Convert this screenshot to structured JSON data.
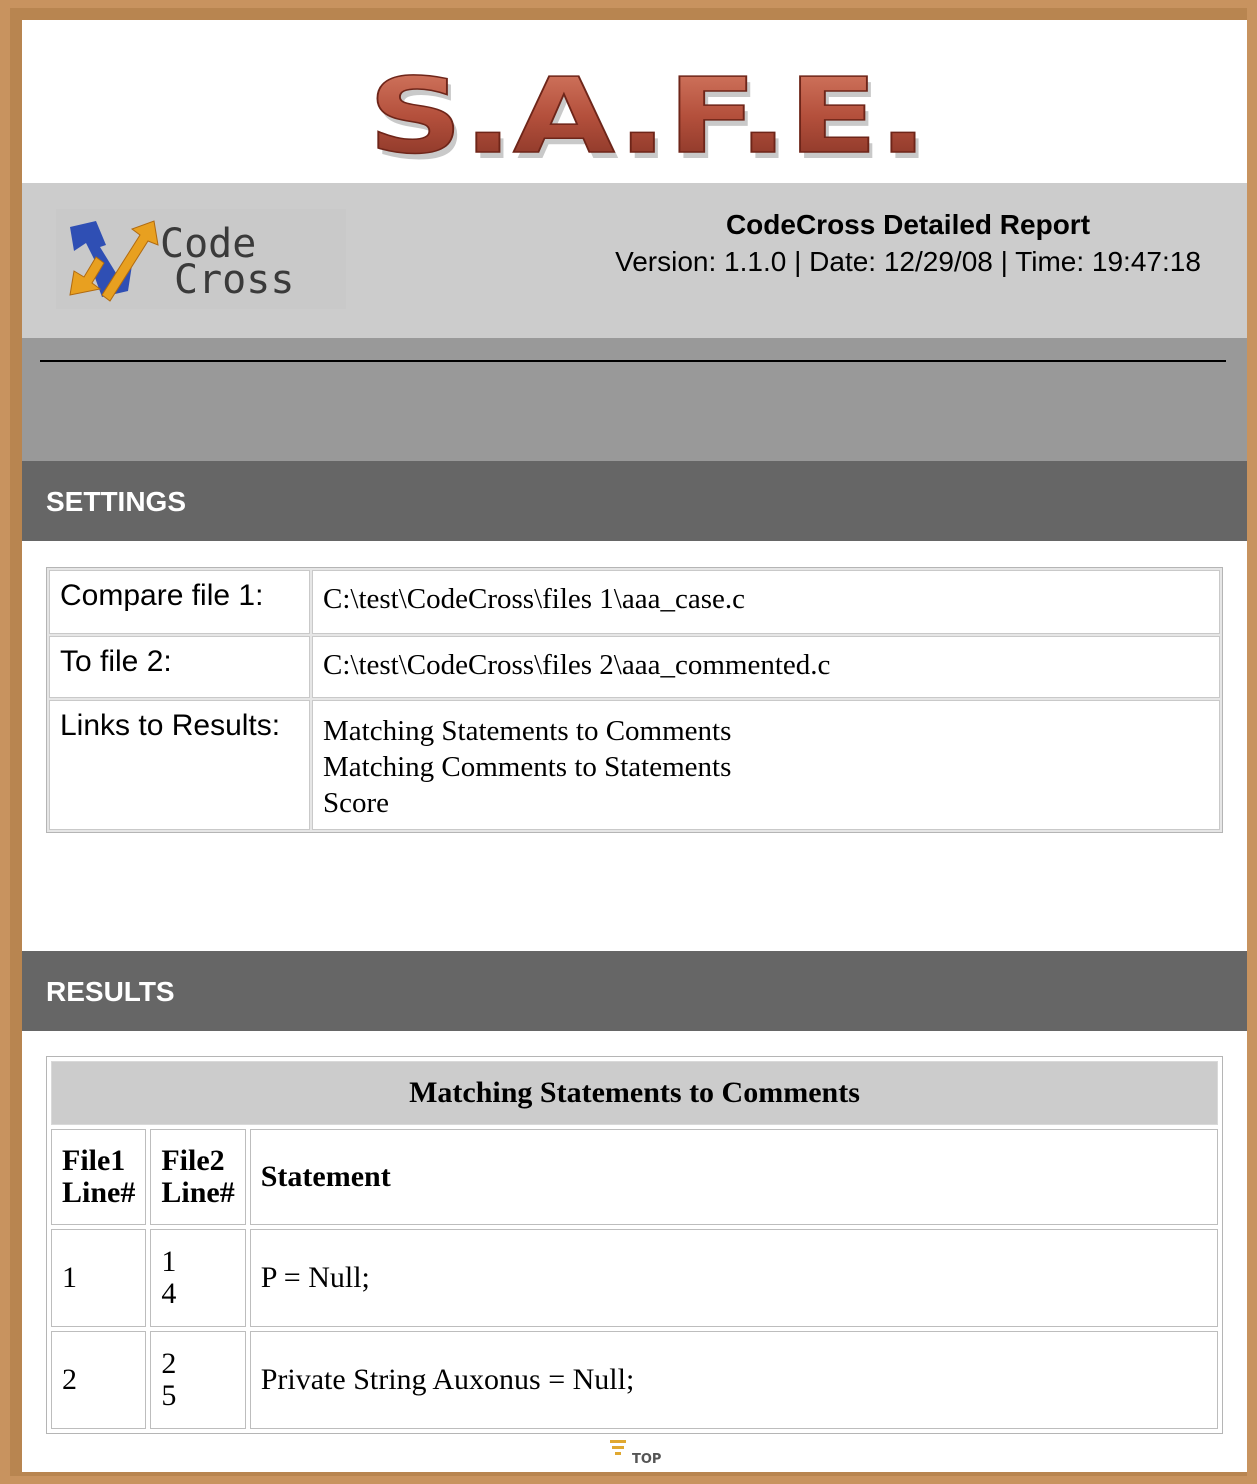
{
  "banner": {
    "logo_text": "S.A.F.E."
  },
  "header": {
    "codecross_logo": {
      "line1": "Code",
      "line2": "Cross"
    },
    "title": "CodeCross Detailed Report",
    "meta": "Version: 1.1.0 | Date: 12/29/08 | Time: 19:47:18"
  },
  "sections": {
    "settings": "SETTINGS",
    "results": "RESULTS"
  },
  "settings": {
    "compare_label": "Compare file 1:",
    "compare_value": "C:\\test\\CodeCross\\files 1\\aaa_case.c",
    "to_label": "To file 2:",
    "to_value": "C:\\test\\CodeCross\\files 2\\aaa_commented.c",
    "links_label": "Links to Results:",
    "links": [
      "Matching Statements to Comments",
      "Matching Comments to Statements",
      "Score"
    ]
  },
  "results_table": {
    "caption": "Matching Statements to Comments",
    "headers": {
      "file1": "File1\nLine#",
      "file2": "File2\nLine#",
      "statement": "Statement"
    },
    "rows": [
      {
        "file1": "1",
        "file2": [
          "1",
          "4"
        ],
        "statement": "P = Null;"
      },
      {
        "file1": "2",
        "file2": [
          "2",
          "5"
        ],
        "statement": "Private String Auxonus = Null;"
      }
    ]
  },
  "top_link": "TOP",
  "colors": {
    "brand_red": "#b04a3a",
    "band_light": "#cccccc",
    "band_mid": "#999999",
    "section_bar": "#666666"
  }
}
